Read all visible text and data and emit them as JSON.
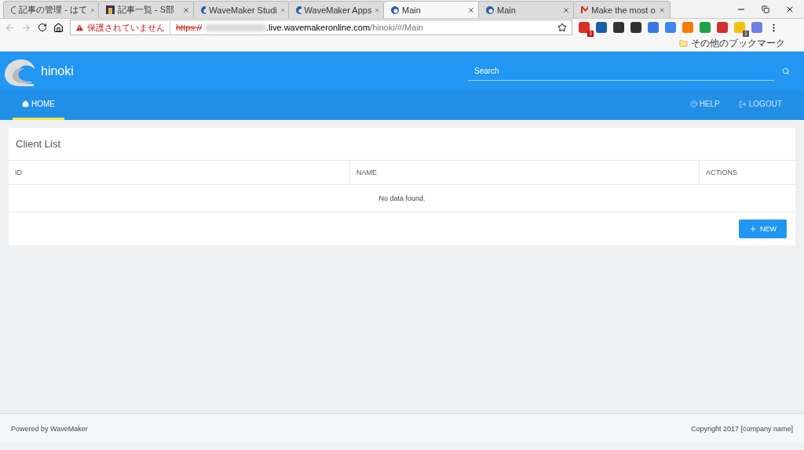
{
  "browser": {
    "tabs": [
      {
        "title": "記事の管理 - はて",
        "kind": "circle",
        "selected": false
      },
      {
        "title": "記事一覧 - S部",
        "kind": "photo",
        "selected": false
      },
      {
        "title": "WaveMaker Studi",
        "kind": "wave",
        "selected": false
      },
      {
        "title": "WaveMaker Apps",
        "kind": "wave",
        "selected": false
      },
      {
        "title": "Main",
        "kind": "wave",
        "selected": true
      },
      {
        "title": "Main",
        "kind": "wave",
        "selected": false
      },
      {
        "title": "Make the most o",
        "kind": "mail",
        "selected": false
      }
    ],
    "security_label": "保護されていません",
    "url": {
      "scheme": "https://",
      "host": ".live.wavemakeronline.com",
      "path": "/hinoki/#/Main"
    },
    "extensions": [
      {
        "kind": "mail",
        "color": "#d93025",
        "badge": "3"
      },
      {
        "kind": "book",
        "color": "#1a5fa8"
      },
      {
        "kind": "cloud",
        "color": "#333333"
      },
      {
        "kind": "elephant",
        "color": "#333333"
      },
      {
        "kind": "chat",
        "color": "#3b78e7"
      },
      {
        "kind": "check",
        "color": "#4285f4"
      },
      {
        "kind": "chart",
        "color": "#f57c00"
      },
      {
        "kind": "leaf",
        "color": "#1ea446"
      },
      {
        "kind": "pin",
        "color": "#d32f2f"
      },
      {
        "kind": "square",
        "color": "#f4c20d",
        "badge": "1"
      },
      {
        "kind": "circle",
        "color": "#6f7fe6"
      }
    ],
    "bookmark_folder": "その他のブックマーク"
  },
  "app": {
    "name": "hinoki",
    "search": {
      "placeholder": "Search"
    },
    "nav": [
      {
        "label": "HOME",
        "kind": "home",
        "selected": true
      }
    ],
    "nav_right": [
      {
        "label": "HELP",
        "kind": "help"
      },
      {
        "label": "LOGOUT",
        "kind": "logout"
      }
    ],
    "panel": {
      "title": "Client List",
      "columns": [
        "ID",
        "NAME",
        "ACTIONS"
      ],
      "empty_message": "No data found.",
      "new_button": "NEW"
    },
    "footer": {
      "left": "Powered by WaveMaker",
      "right": "Copyright 2017 [company name]"
    }
  }
}
